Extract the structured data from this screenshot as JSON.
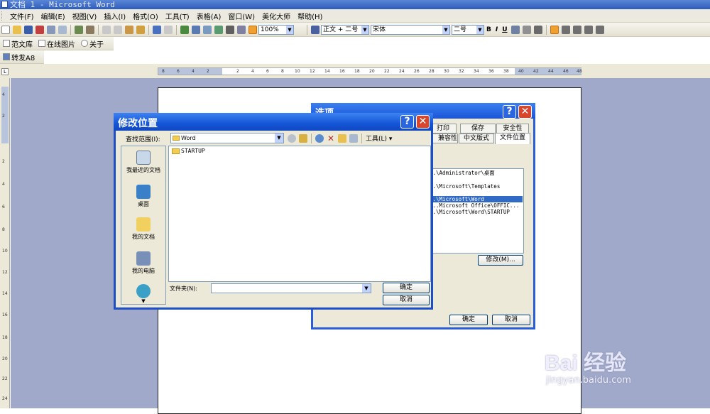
{
  "window": {
    "title": "文档 1 - Microsoft Word"
  },
  "menu": [
    "文件(F)",
    "编辑(E)",
    "视图(V)",
    "插入(I)",
    "格式(O)",
    "工具(T)",
    "表格(A)",
    "窗口(W)",
    "美化大师",
    "帮助(H)"
  ],
  "toolbar": {
    "zoom": "100%",
    "style": "正文 + 二号",
    "font": "宋体",
    "size": "二号",
    "bold": "B",
    "italic": "I",
    "underline": "U"
  },
  "toolbar2": {
    "items": [
      "范文库",
      "在线图片",
      "关于"
    ]
  },
  "toolbar3": {
    "item": "转发A8"
  },
  "ruler": {
    "corner": "L",
    "ticks": [
      "8",
      "6",
      "4",
      "2",
      "2",
      "4",
      "6",
      "8",
      "10",
      "12",
      "14",
      "16",
      "18",
      "20",
      "22",
      "24",
      "26",
      "28",
      "30",
      "32",
      "34",
      "36",
      "38",
      "40",
      "42",
      "44",
      "46",
      "48"
    ]
  },
  "vruler": {
    "ticks": [
      "4",
      "2",
      "2",
      "4",
      "6",
      "8",
      "10",
      "12",
      "14",
      "16",
      "18",
      "20",
      "22",
      "24"
    ]
  },
  "options_dialog": {
    "title": "选项",
    "tabs_row1": [
      "打印",
      "保存",
      "安全性"
    ],
    "tabs_row2": [
      "兼容性",
      "中文版式",
      "文件位置"
    ],
    "list": [
      "..\\Administrator\\桌面",
      "..\\Microsoft\\Templates",
      "..\\Microsoft\\Word",
      "...Microsoft Office\\OFFIC...",
      "..\\Microsoft\\Word\\STARTUP"
    ],
    "modify_button": "修改(M)...",
    "ok": "确定",
    "cancel": "取消"
  },
  "modify_dialog": {
    "title": "修改位置",
    "help": "?",
    "close": "✕",
    "lookin_label": "查找范围(I):",
    "lookin_value": "Word",
    "tools_label": "工具(L) ▾",
    "places": [
      "我最近的文档",
      "桌面",
      "我的文档",
      "我的电脑"
    ],
    "files": [
      "STARTUP"
    ],
    "folder_label": "文件夹(N):",
    "folder_value": "",
    "ok": "确定",
    "cancel": "取消"
  },
  "watermark": {
    "brand": "Bai 经验",
    "url": "jingyan.baidu.com"
  }
}
